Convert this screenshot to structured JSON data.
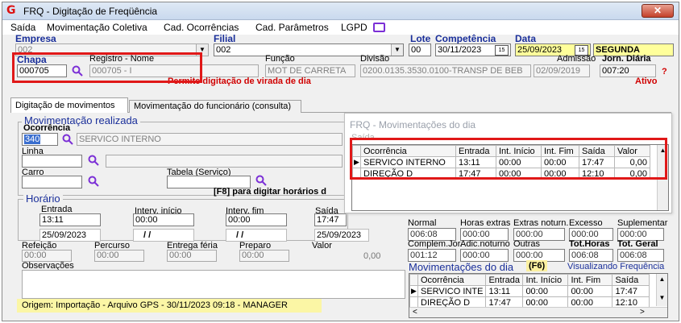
{
  "window": {
    "title": "FRQ - Digitação de Freqüência",
    "close_label": "✕"
  },
  "menu": {
    "items": [
      "Saída",
      "Movimentação Coletiva",
      "Cad. Ocorrências",
      "Cad. Parâmetros",
      "LGPD"
    ]
  },
  "header": {
    "empresa_label": "Empresa",
    "empresa_value": "002",
    "filial_label": "Filial",
    "filial_value": "002",
    "lote_label": "Lote",
    "lote_value": "00",
    "competencia_label": "Competência",
    "competencia_value": "30/11/2023",
    "data_label": "Data",
    "data_value": "25/09/2023",
    "weekday": "SEGUNDA",
    "chapa_label": "Chapa",
    "chapa_value": "000705",
    "registro_label": "Registro - Nome",
    "registro_value": "000705 - I",
    "funcao_label": "Função",
    "funcao_value": "MOT DE CARRETA",
    "divisao_label": "Divisão",
    "divisao_value": "0200.0135.3530.0100-TRANSP DE BEB",
    "admissao_label": "Admissão",
    "admissao_value": "02/09/2019",
    "jornada_label": "Jorn. Diária",
    "jornada_value": "007:20",
    "help": "?",
    "notice": "Permite digitação de virada de dia",
    "status": "Ativo"
  },
  "tabs": [
    "Digitação de movimentos",
    "Movimentação do funcionário (consulta)"
  ],
  "movimentacao": {
    "group_title": "Movimentação realizada",
    "ocorrencia_label": "Ocorrência",
    "ocorrencia_code": "340",
    "ocorrencia_desc": "SERVICO INTERNO",
    "linha_label": "Linha",
    "carro_label": "Carro",
    "tabela_label": "Tabela (Serviço)",
    "f8_hint": "[F8] para digitar horários d"
  },
  "horario": {
    "group_title": "Horário",
    "entrada_label": "Entrada",
    "entrada_value": "13:11",
    "entrada_date": "25/09/2023",
    "interv_ini_label": "Interv. início",
    "interv_ini_value": "00:00",
    "interv_ini_date": "/ /",
    "interv_fim_label": "Interv. fim",
    "interv_fim_value": "00:00",
    "interv_fim_date": "/ /",
    "saida_label": "Saída",
    "saida_value": "17:47",
    "saida_date": "25/09/2023"
  },
  "extras": {
    "refeicao_label": "Refeição",
    "refeicao_value": "00:00",
    "percurso_label": "Percurso",
    "percurso_value": "00:00",
    "entrega_label": "Entrega féria",
    "entrega_value": "00:00",
    "preparo_label": "Preparo",
    "preparo_value": "00:00",
    "valor_label": "Valor",
    "valor_value": "0,00",
    "observacoes_label": "Observações"
  },
  "origem": "Origem: Importação - Arquivo GPS - 30/11/2023 09:18 - MANAGER",
  "popup": {
    "title": "FRQ - Movimentações do dia",
    "menu": "Saída",
    "columns": [
      "Ocorrência",
      "Entrada",
      "Int. Início",
      "Int. Fim",
      "Saída",
      "Valor"
    ],
    "rows": [
      [
        "SERVICO INTERNO",
        "13:11",
        "00:00",
        "00:00",
        "17:47",
        "0,00"
      ],
      [
        "DIREÇÃO D",
        "17:47",
        "00:00",
        "00:00",
        "12:10",
        "0,00"
      ]
    ]
  },
  "totals": {
    "labels1": [
      "Normal",
      "Horas extras",
      "Extras noturn.",
      "Excesso",
      "Suplementar"
    ],
    "values1": [
      "006:08",
      "000:00",
      "000:00",
      "000:00",
      "000:00"
    ],
    "labels2": [
      "Complem.Jor.",
      "Adic.noturno",
      "Outras",
      "Tot.Horas",
      "Tot. Geral"
    ],
    "values2": [
      "001:12",
      "000:00",
      "000:00",
      "006:08",
      "006:08"
    ]
  },
  "day_moves": {
    "title": "Movimentações do dia",
    "key": "(F6)",
    "viewing": "Visualizando Frequência",
    "columns": [
      "Ocorrência",
      "Entrada",
      "Int. Início",
      "Int. Fim",
      "Saída"
    ],
    "rows": [
      [
        "SERVICO INTE",
        "13:11",
        "00:00",
        "00:00",
        "17:47"
      ],
      [
        "DIREÇÃO D",
        "17:47",
        "00:00",
        "00:00",
        "12:10"
      ]
    ]
  }
}
